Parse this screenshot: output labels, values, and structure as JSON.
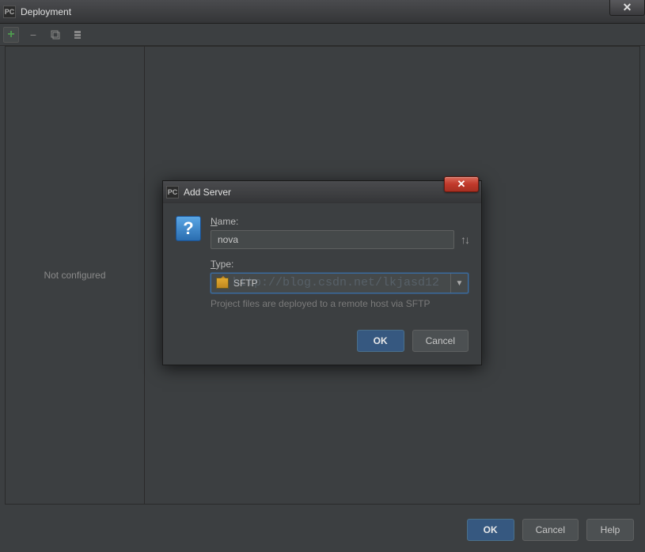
{
  "main_window": {
    "title": "Deployment",
    "app_icon_text": "PC",
    "close_glyph": "✕"
  },
  "toolbar": {
    "add_glyph": "+",
    "remove_glyph": "−"
  },
  "sidebar": {
    "empty_text": "Not configured"
  },
  "modal": {
    "title": "Add Server",
    "app_icon_text": "PC",
    "close_glyph": "✕",
    "question_icon": "?",
    "name_label": "Name:",
    "name_value": "nova",
    "sort_glyph": "↑↓",
    "type_label": "Type:",
    "type_value": "SFTP",
    "dropdown_arrow": "▼",
    "help_text": "Project files are deployed to a remote host via SFTP",
    "ok_label": "OK",
    "cancel_label": "Cancel",
    "watermark": "http://blog.csdn.net/lkjasd12"
  },
  "bottom": {
    "ok_label": "OK",
    "cancel_label": "Cancel",
    "help_label": "Help"
  }
}
